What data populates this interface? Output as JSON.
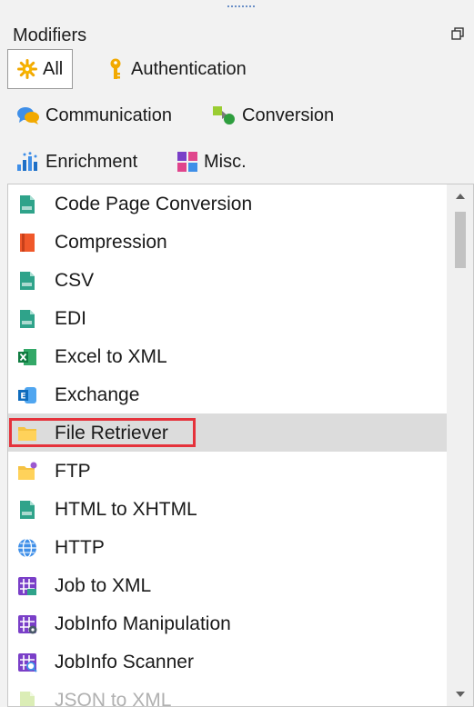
{
  "panel": {
    "title": "Modifiers"
  },
  "filters": [
    {
      "label": "All",
      "icon": "gear-sun-icon",
      "active": true
    },
    {
      "label": "Authentication",
      "icon": "key-icon",
      "active": false
    },
    {
      "label": "Communication",
      "icon": "chat-bubbles-icon",
      "active": false
    },
    {
      "label": "Conversion",
      "icon": "conversion-icon",
      "active": false
    },
    {
      "label": "Enrichment",
      "icon": "enrichment-icon",
      "active": false
    },
    {
      "label": "Misc.",
      "icon": "misc-blocks-icon",
      "active": false
    }
  ],
  "items": [
    {
      "label": "Code Page Conversion",
      "icon": "asc-file-icon"
    },
    {
      "label": "Compression",
      "icon": "compression-icon"
    },
    {
      "label": "CSV",
      "icon": "csv-file-icon"
    },
    {
      "label": "EDI",
      "icon": "edi-file-icon"
    },
    {
      "label": "Excel to XML",
      "icon": "excel-icon"
    },
    {
      "label": "Exchange",
      "icon": "exchange-icon"
    },
    {
      "label": "File Retriever",
      "icon": "folder-icon",
      "selected": true
    },
    {
      "label": "FTP",
      "icon": "ftp-folder-icon"
    },
    {
      "label": "HTML to XHTML",
      "icon": "html-file-icon"
    },
    {
      "label": "HTTP",
      "icon": "globe-icon"
    },
    {
      "label": "Job to XML",
      "icon": "job-grid-icon"
    },
    {
      "label": "JobInfo Manipulation",
      "icon": "job-gear-icon"
    },
    {
      "label": "JobInfo Scanner",
      "icon": "job-search-icon"
    },
    {
      "label": "JSON to XML",
      "icon": "json-file-icon",
      "faded": true
    }
  ],
  "colors": {
    "selection": "#dcdcdc",
    "highlight_border": "#e5323b",
    "accent": "#6a8fc7"
  }
}
